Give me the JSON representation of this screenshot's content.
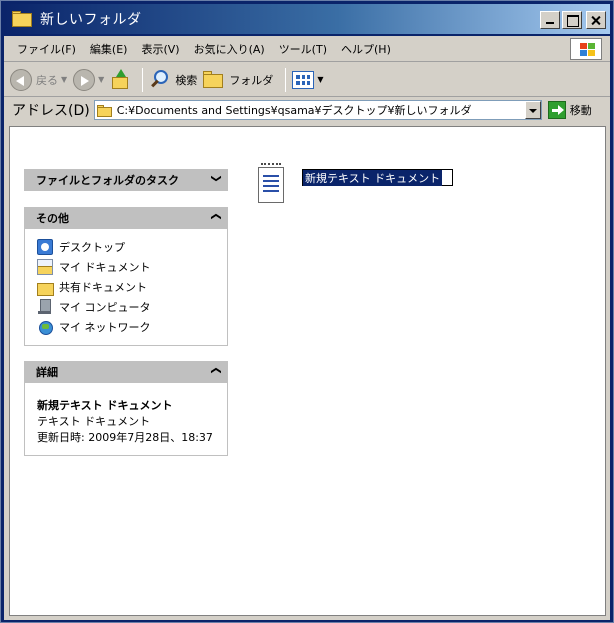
{
  "window": {
    "title": "新しいフォルダ"
  },
  "menubar": {
    "items": [
      "ファイル(F)",
      "編集(E)",
      "表示(V)",
      "お気に入り(A)",
      "ツール(T)",
      "ヘルプ(H)"
    ]
  },
  "toolbar": {
    "back_label": "戻る",
    "search_label": "検索",
    "folders_label": "フォルダ"
  },
  "address": {
    "label": "アドレス(D)",
    "path": "C:¥Documents and Settings¥qsama¥デスクトップ¥新しいフォルダ",
    "go_label": "移動"
  },
  "panels": {
    "tasks": {
      "title": "ファイルとフォルダのタスク",
      "chevron": "❯"
    },
    "other": {
      "title": "その他",
      "chevron": "❯",
      "links": [
        "デスクトップ",
        "マイ ドキュメント",
        "共有ドキュメント",
        "マイ コンピュータ",
        "マイ ネットワーク"
      ]
    },
    "details": {
      "title": "詳細",
      "chevron": "❯",
      "name": "新規テキスト ドキュメント",
      "type": "テキスト ドキュメント",
      "modified": "更新日時: 2009年7月28日、18:37"
    }
  },
  "file": {
    "name": "新規テキスト ドキュメント"
  },
  "colors": {
    "title_start": "#0a246a",
    "title_end": "#a6caf0",
    "selection": "#0a246a"
  }
}
